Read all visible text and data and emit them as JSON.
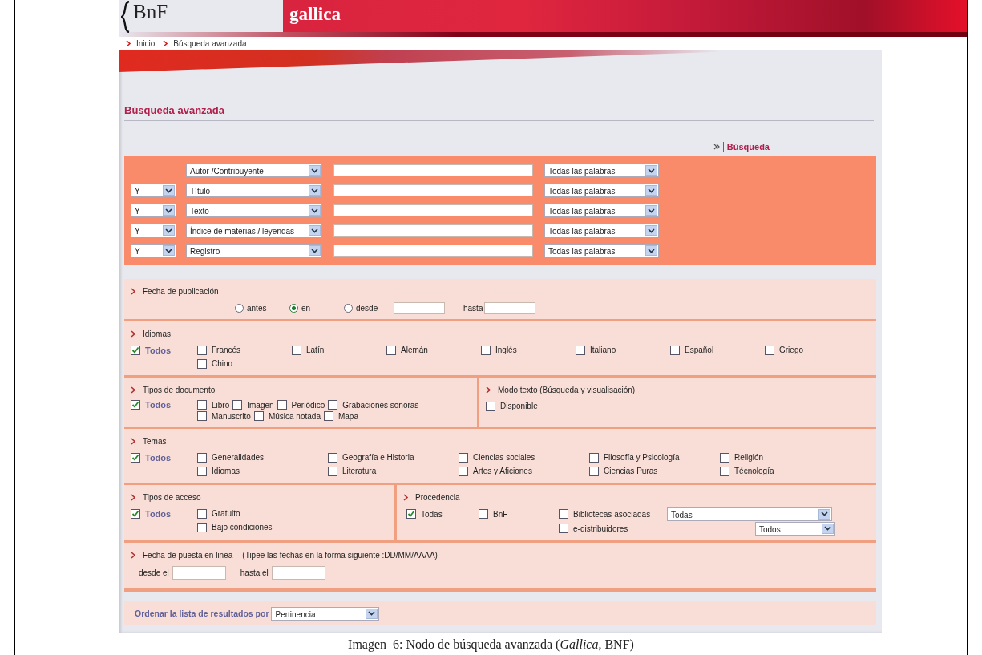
{
  "header": {
    "logo": "BnF",
    "site": "gallica"
  },
  "breadcrumb": [
    {
      "label": "Inicio"
    },
    {
      "label": "Búsqueda avanzada"
    }
  ],
  "page_title": "Búsqueda avanzada",
  "search_link": "Búsqueda",
  "criteria": [
    {
      "field": "Autor /Contribuyente",
      "match": "Todas las palabras"
    },
    {
      "operator": "Y",
      "field": "Título",
      "match": "Todas las palabras"
    },
    {
      "operator": "Y",
      "field": "Texto",
      "match": "Todas las palabras"
    },
    {
      "operator": "Y",
      "field": "Índice de materias / leyendas",
      "match": "Todas las palabras"
    },
    {
      "operator": "Y",
      "field": "Registro",
      "match": "Todas las palabras"
    }
  ],
  "publication_date": {
    "title": "Fecha de publicación",
    "options": [
      {
        "label": "antes",
        "selected": false
      },
      {
        "label": "en",
        "selected": true
      },
      {
        "label": "desde",
        "selected": false
      }
    ],
    "to_label": "hasta"
  },
  "languages": {
    "title": "Idiomas",
    "items": [
      {
        "label": "Todos",
        "kind": "all",
        "checked": true
      },
      {
        "label": "Francés",
        "kind": "option",
        "checked": false
      },
      {
        "label": "Latín",
        "kind": "option",
        "checked": false
      },
      {
        "label": "Alemán",
        "kind": "option",
        "checked": false
      },
      {
        "label": "Inglés",
        "kind": "option",
        "checked": false
      },
      {
        "label": "Italiano",
        "kind": "option",
        "checked": false
      },
      {
        "label": "Español",
        "kind": "option",
        "checked": false
      },
      {
        "label": "Griego",
        "kind": "option",
        "checked": false
      },
      {
        "label": "Chino",
        "kind": "option",
        "checked": false
      }
    ]
  },
  "document_types": {
    "title": "Tipos de documento",
    "items": [
      {
        "label": "Todos",
        "kind": "all",
        "checked": true
      },
      {
        "label": "Libro",
        "kind": "option",
        "checked": false
      },
      {
        "label": "Imagen",
        "kind": "option",
        "checked": false
      },
      {
        "label": "Periódico",
        "kind": "option",
        "checked": false
      },
      {
        "label": "Grabaciones sonoras",
        "kind": "option",
        "checked": false
      },
      {
        "label": "Manuscrito",
        "kind": "option",
        "checked": false
      },
      {
        "label": "Música notada",
        "kind": "option",
        "checked": false
      },
      {
        "label": "Mapa",
        "kind": "option",
        "checked": false
      }
    ]
  },
  "text_mode": {
    "title": "Modo texto (Búsqueda y visualisación)",
    "items": [
      {
        "label": "Disponible",
        "kind": "option",
        "checked": false
      }
    ]
  },
  "themes": {
    "title": "Temas",
    "items": [
      {
        "label": "Todos",
        "kind": "all",
        "checked": true
      },
      {
        "label": "Generalidades",
        "kind": "option",
        "checked": false
      },
      {
        "label": "Geografía e Historia",
        "kind": "option",
        "checked": false
      },
      {
        "label": "Ciencias sociales",
        "kind": "option",
        "checked": false
      },
      {
        "label": "Filosofía y Psicología",
        "kind": "option",
        "checked": false
      },
      {
        "label": "Religión",
        "kind": "option",
        "checked": false
      },
      {
        "label": "Idiomas",
        "kind": "option",
        "checked": false
      },
      {
        "label": "Literatura",
        "kind": "option",
        "checked": false
      },
      {
        "label": "Artes y Aficiones",
        "kind": "option",
        "checked": false
      },
      {
        "label": "Ciencias Puras",
        "kind": "option",
        "checked": false
      },
      {
        "label": "Técnología",
        "kind": "option",
        "checked": false
      }
    ]
  },
  "access_types": {
    "title": "Tipos de acceso",
    "items": [
      {
        "label": "Todos",
        "kind": "all",
        "checked": true
      },
      {
        "label": "Gratuito",
        "kind": "option",
        "checked": false
      },
      {
        "label": "Bajo condiciones",
        "kind": "option",
        "checked": false
      }
    ]
  },
  "origin": {
    "title": "Procedencia",
    "items": [
      {
        "label": "Todas",
        "kind": "option",
        "checked": true
      },
      {
        "label": "BnF",
        "kind": "option",
        "checked": false
      },
      {
        "label": "Bibliotecas asociadas",
        "kind": "option",
        "checked": false
      },
      {
        "label": "e-distribuidores",
        "kind": "option",
        "checked": false
      }
    ],
    "libraries_select": "Todas",
    "distributors_select": "Todos"
  },
  "online_date": {
    "title": "Fecha de puesta en linea",
    "hint": "(Tipee las fechas en la forma siguiente :DD/MM/AAAA)",
    "from_label": "desde el",
    "to_label": "hasta el"
  },
  "sort": {
    "label": "Ordenar la lista de resultados por",
    "value": "Pertinencia"
  },
  "caption": "Imagen  6: Nodo de búsqueda avanzada (*Gallica*, BNF)"
}
